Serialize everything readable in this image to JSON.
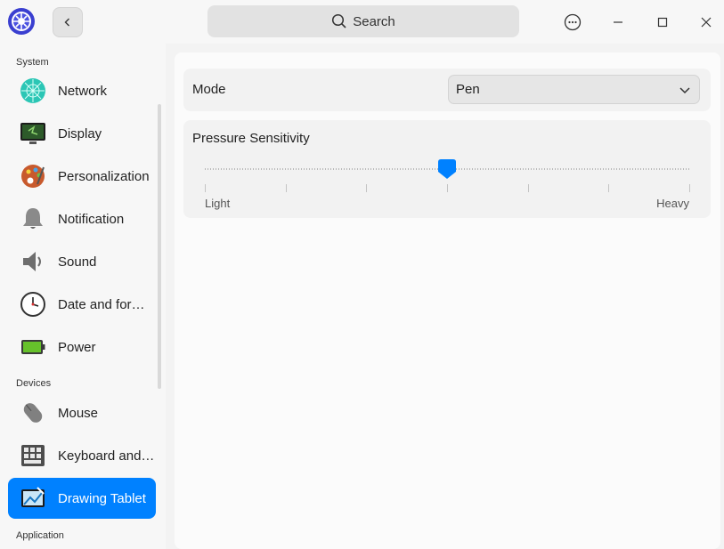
{
  "titlebar": {
    "search_placeholder": "Search"
  },
  "sidebar": {
    "sections": [
      {
        "label": "System"
      },
      {
        "label": "Devices"
      },
      {
        "label": "Application"
      }
    ],
    "items": [
      {
        "label": "Network",
        "icon": "network-icon"
      },
      {
        "label": "Display",
        "icon": "display-icon"
      },
      {
        "label": "Personalization",
        "icon": "palette-icon"
      },
      {
        "label": "Notification",
        "icon": "bell-icon"
      },
      {
        "label": "Sound",
        "icon": "speaker-icon"
      },
      {
        "label": "Date and for…",
        "icon": "clock-icon"
      },
      {
        "label": "Power",
        "icon": "battery-icon"
      },
      {
        "label": "Mouse",
        "icon": "mouse-icon"
      },
      {
        "label": "Keyboard and…",
        "icon": "keyboard-icon"
      },
      {
        "label": "Drawing Tablet",
        "icon": "tablet-icon",
        "active": true
      }
    ]
  },
  "main": {
    "mode": {
      "label": "Mode",
      "value": "Pen"
    },
    "pressure": {
      "title": "Pressure Sensitivity",
      "min_label": "Light",
      "max_label": "Heavy",
      "level": 0.5
    }
  },
  "colors": {
    "accent": "#0081ff"
  }
}
